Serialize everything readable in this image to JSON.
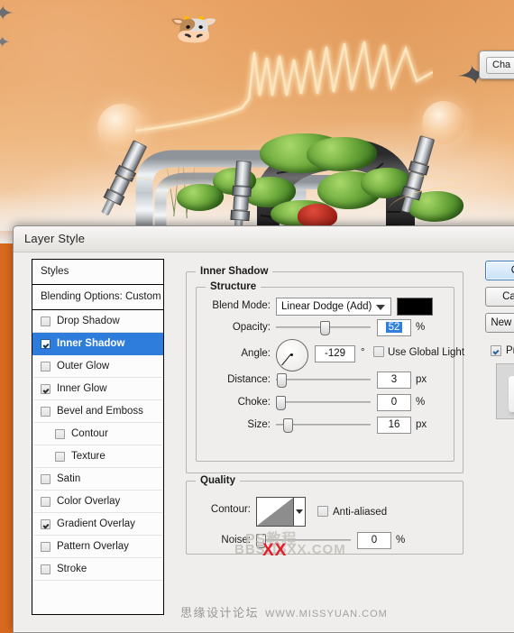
{
  "background": {
    "description": "Photoshop canvas artwork: orange sky with birds, neon glowing sound-wave, glowing orbs, chrome spark plugs, pipes, corrugated hose and green foliage",
    "sky_color": "#eaa96c",
    "neon_color": "#ffe2a8",
    "foliage_color": "#6ba83b"
  },
  "panel_tab": {
    "label": "Cha"
  },
  "dialog": {
    "title": "Layer Style"
  },
  "styles_list": {
    "header": "Styles",
    "blending_options": "Blending Options: Custom",
    "items": [
      {
        "label": "Drop Shadow",
        "checked": false,
        "selected": false,
        "indent": false
      },
      {
        "label": "Inner Shadow",
        "checked": true,
        "selected": true,
        "indent": false
      },
      {
        "label": "Outer Glow",
        "checked": false,
        "selected": false,
        "indent": false
      },
      {
        "label": "Inner Glow",
        "checked": true,
        "selected": false,
        "indent": false
      },
      {
        "label": "Bevel and Emboss",
        "checked": false,
        "selected": false,
        "indent": false
      },
      {
        "label": "Contour",
        "checked": false,
        "selected": false,
        "indent": true
      },
      {
        "label": "Texture",
        "checked": false,
        "selected": false,
        "indent": true
      },
      {
        "label": "Satin",
        "checked": false,
        "selected": false,
        "indent": false
      },
      {
        "label": "Color Overlay",
        "checked": false,
        "selected": false,
        "indent": false
      },
      {
        "label": "Gradient Overlay",
        "checked": true,
        "selected": false,
        "indent": false
      },
      {
        "label": "Pattern Overlay",
        "checked": false,
        "selected": false,
        "indent": false
      },
      {
        "label": "Stroke",
        "checked": false,
        "selected": false,
        "indent": false
      }
    ]
  },
  "panel": {
    "group_title": "Inner Shadow",
    "structure": {
      "title": "Structure",
      "blend_mode_label": "Blend Mode:",
      "blend_mode_value": "Linear Dodge (Add)",
      "blend_color": "#000000",
      "opacity_label": "Opacity:",
      "opacity_value": "52",
      "opacity_unit": "%",
      "angle_label": "Angle:",
      "angle_value": "-129",
      "angle_unit": "°",
      "use_global_light_label": "Use Global Light",
      "use_global_light_checked": false,
      "distance_label": "Distance:",
      "distance_value": "3",
      "distance_unit": "px",
      "choke_label": "Choke:",
      "choke_value": "0",
      "choke_unit": "%",
      "size_label": "Size:",
      "size_value": "16",
      "size_unit": "px"
    },
    "quality": {
      "title": "Quality",
      "contour_label": "Contour:",
      "anti_aliased_label": "Anti-aliased",
      "anti_aliased_checked": false,
      "noise_label": "Noise:",
      "noise_value": "0",
      "noise_unit": "%"
    }
  },
  "buttons": {
    "ok": "OK",
    "cancel": "Cancel",
    "new_style": "New Style...",
    "preview_label": "Preview",
    "preview_checked": true
  },
  "watermarks": {
    "overlay_line1": "PS教程",
    "overlay_line2": "BBS.16XX.COM",
    "overlay_accent": "XX",
    "bottom_cn": "思缘设计论坛",
    "bottom_url": "WWW.MISSYUAN.COM"
  }
}
